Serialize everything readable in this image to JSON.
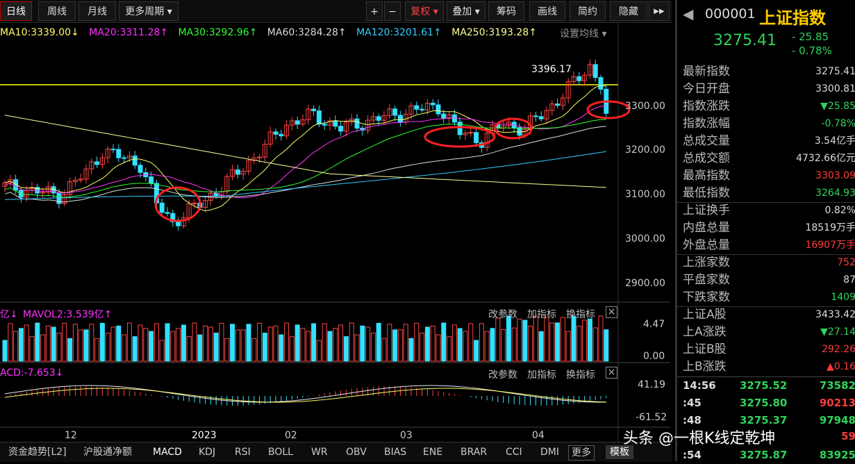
{
  "toolbar": {
    "tabs": [
      "日线",
      "周线",
      "月线",
      "更多周期"
    ],
    "zoom_in": "+",
    "zoom_out": "−",
    "fuquan": "复权",
    "overlay": "叠加",
    "chips": "筹码",
    "draw": "画线",
    "simple": "简约",
    "hide": "隐藏",
    "expand": "▶▶"
  },
  "ma_bar": {
    "ma10": "MA10:3339.00↓",
    "ma20": "MA20:3311.28↑",
    "ma30": "MA30:3292.96↑",
    "ma60": "MA60:3284.28↑",
    "ma120": "MA120:3201.61↑",
    "ma250": "MA250:3193.28↑",
    "settings": "设置均线"
  },
  "colors": {
    "ma10": "#ffff66",
    "ma20": "#ff33ff",
    "ma30": "#33ff33",
    "ma60": "#dddddd",
    "ma120": "#33ccff",
    "ma250": "#ffff99",
    "up": "#ff4444",
    "down": "#33e0ff",
    "annotation": "#ff2020"
  },
  "price_axis": [
    "3300.00",
    "3200.00",
    "3100.00",
    "3000.00",
    "2900.00"
  ],
  "high_label": "3396.17",
  "volume_panel": {
    "title_a": "亿↓",
    "title_b": "MAVOL2:3.539亿↑",
    "axis": [
      "4.47",
      "0.00"
    ],
    "btn_params": "改参数",
    "btn_add": "加指标",
    "btn_switch": "换指标",
    "btn_close": "×"
  },
  "macd_panel": {
    "title": "ACD:-7.653↓",
    "axis": [
      "41.19",
      "-61.52"
    ],
    "btn_params": "改参数",
    "btn_add": "加指标",
    "btn_switch": "换指标",
    "btn_close": "×"
  },
  "x_axis": [
    "12",
    "2023",
    "02",
    "03",
    "04"
  ],
  "bottom_tabs": [
    "资金趋势[L2]",
    "沪股通净额",
    "MACD",
    "KDJ",
    "RSI",
    "BOLL",
    "WR",
    "OBV",
    "BIAS",
    "ENE",
    "BRAR",
    "CCI",
    "DMI",
    "更多",
    "模板"
  ],
  "quote": {
    "code": "000001",
    "name": "上证指数",
    "price": "3275.41",
    "change": "- 25.85",
    "change_pct": "- 0.78%",
    "nav_icon": "◀"
  },
  "stats": [
    {
      "label": "最新指数",
      "value": "3275.41",
      "color": "white"
    },
    {
      "label": "今日开盘",
      "value": "3300.81",
      "color": "white"
    },
    {
      "label": "指数涨跌",
      "value": "▼25.85",
      "color": "green"
    },
    {
      "label": "指数涨幅",
      "value": "-0.78%",
      "color": "green"
    },
    {
      "label": "总成交量",
      "value": "3.54亿手",
      "color": "white"
    },
    {
      "label": "总成交额",
      "value": "4732.66亿元",
      "color": "white"
    },
    {
      "label": "最高指数",
      "value": "3303.09",
      "color": "red"
    },
    {
      "label": "最低指数",
      "value": "3264.93",
      "color": "green"
    },
    {
      "label": "上证换手",
      "value": "0.82%",
      "color": "white"
    },
    {
      "label": "内盘总量",
      "value": "18519万手",
      "color": "white"
    },
    {
      "label": "外盘总量",
      "value": "16907万手",
      "color": "red"
    },
    {
      "label": "上涨家数",
      "value": "752",
      "color": "red"
    },
    {
      "label": "平盘家数",
      "value": "87",
      "color": "white"
    },
    {
      "label": "下跌家数",
      "value": "1409",
      "color": "green"
    },
    {
      "label": "上证A股",
      "value": "3433.42",
      "color": "white"
    },
    {
      "label": "上A涨跌",
      "value": "▼27.14",
      "color": "green"
    },
    {
      "label": "上证B股",
      "value": "292.26",
      "color": "red"
    },
    {
      "label": "上B涨跌",
      "value": "▲0.16",
      "color": "red"
    }
  ],
  "ticks": [
    {
      "time": "14:56",
      "price": "3275.52",
      "vol": "73582"
    },
    {
      "time": ":45",
      "price": "3275.80",
      "vol": "90213"
    },
    {
      "time": ":48",
      "price": "3275.37",
      "vol": "97948"
    },
    {
      "time": "",
      "price": "",
      "vol": "59"
    },
    {
      "time": ":54",
      "price": "3275.87",
      "vol": "83925"
    }
  ],
  "watermark": "头条 @一根K线定乾坤"
}
